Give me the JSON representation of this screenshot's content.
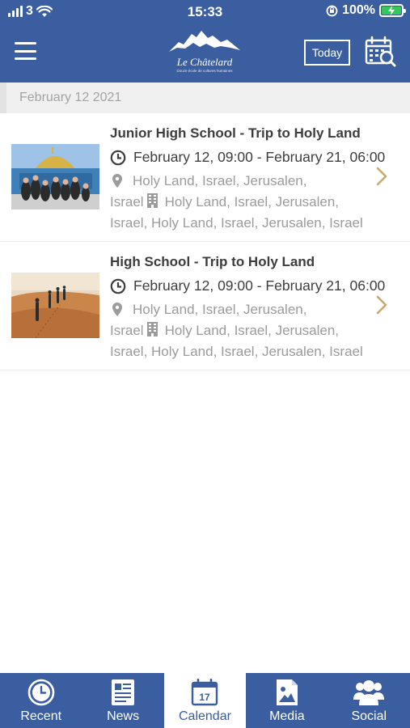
{
  "status_bar": {
    "carrier": "3",
    "time": "15:33",
    "battery": "100%"
  },
  "header": {
    "logo_text": "Le Châtelard",
    "logo_subtitle": "Douze école de cultures humaines",
    "today_label": "Today"
  },
  "date_header": "February 12 2021",
  "events": [
    {
      "title": "Junior High School - Trip to Holy Land",
      "time": "February 12, 09:00 - February 21, 06:00",
      "location_first": "Holy Land, Israel, Jerusalen,",
      "location_second": "Israel",
      "venue": "Holy Land, Israel, Jerusalen,",
      "venue_rest": "Israel, Holy Land, Israel, Jerusalen, Israel"
    },
    {
      "title": "High School - Trip to Holy Land",
      "time": "February 12, 09:00 - February 21, 06:00",
      "location_first": "Holy Land, Israel, Jerusalen,",
      "location_second": "Israel",
      "venue": "Holy Land, Israel, Jerusalen,",
      "venue_rest": "Israel, Holy Land, Israel, Jerusalen, Israel"
    }
  ],
  "tabs": [
    {
      "label": "Recent",
      "icon": "clock-icon"
    },
    {
      "label": "News",
      "icon": "newspaper-icon"
    },
    {
      "label": "Calendar",
      "icon": "calendar-icon",
      "badge": "17",
      "active": true
    },
    {
      "label": "Media",
      "icon": "image-icon"
    },
    {
      "label": "Social",
      "icon": "people-icon"
    }
  ],
  "colors": {
    "brand_blue": "#3a5ea0",
    "gold_chevron": "#c9a96e",
    "muted_text": "#9b9b9b"
  }
}
